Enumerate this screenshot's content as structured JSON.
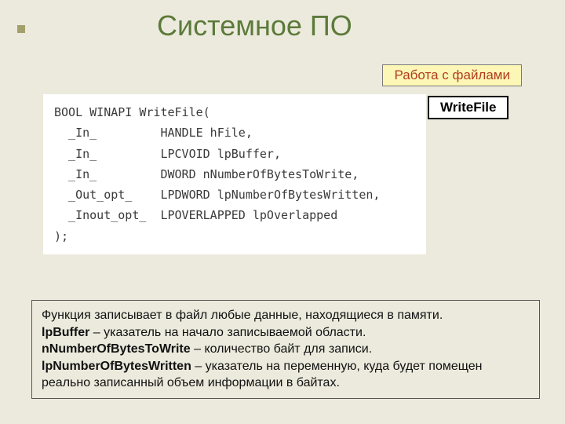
{
  "title": "Системное ПО",
  "tag_yellow": "Работа с файлами",
  "tag_white": "WriteFile",
  "code": "BOOL WINAPI WriteFile(\n  _In_         HANDLE hFile,\n  _In_         LPCVOID lpBuffer,\n  _In_         DWORD nNumberOfBytesToWrite,\n  _Out_opt_    LPDWORD lpNumberOfBytesWritten,\n  _Inout_opt_  LPOVERLAPPED lpOverlapped\n);",
  "desc": {
    "line1": "Функция записывает в файл любые данные, находящиеся в памяти.",
    "p1_name": "lpBuffer",
    "p1_text": " – указатель на начало записываемой области.",
    "p2_name": "nNumberOfBytesToWrite",
    "p2_text": " – количество байт для записи.",
    "p3_name": "lpNumberOfBytesWritten",
    "p3_text": " – указатель на переменную, куда будет помещен реально записанный объем информации в байтах."
  }
}
